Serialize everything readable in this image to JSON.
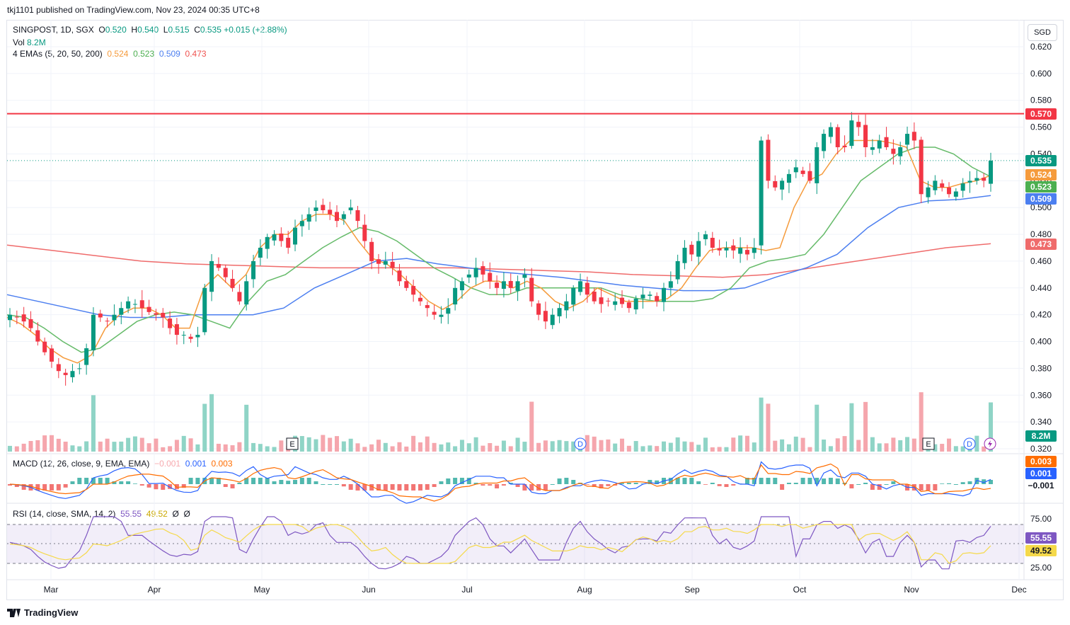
{
  "header": {
    "publisher": "tkj1101 published on TradingView.com, Nov 23, 2024 00:35 UTC+8"
  },
  "symbol": {
    "title": "SINGPOST, 1D, SGX",
    "o_label": "O",
    "o": "0.520",
    "h_label": "H",
    "h": "0.540",
    "l_label": "L",
    "l": "0.515",
    "c_label": "C",
    "c": "0.535",
    "change": "+0.015 (+2.88%)"
  },
  "volume": {
    "label": "Vol",
    "value": "8.2M",
    "axis_label": "8.2M"
  },
  "ema_legend": {
    "label": "4 EMAs (5, 20, 50, 200)",
    "v5": "0.524",
    "v20": "0.523",
    "v50": "0.509",
    "v200": "0.473"
  },
  "macd_legend": {
    "label": "MACD (12, 26, close, 9, EMA, EMA)",
    "hist": "−0.001",
    "macd": "0.001",
    "signal": "0.003"
  },
  "rsi_legend": {
    "label": "RSI (14, close, SMA, 14, 2)",
    "rsi": "55.55",
    "sma": "49.52",
    "ext1": "Ø",
    "ext2": "Ø"
  },
  "currency": "SGD",
  "footer": {
    "brand": "TradingView"
  },
  "colors": {
    "up": "#089981",
    "down": "#f23645",
    "ema5": "#f59b3c",
    "ema20": "#66bb6a",
    "ema50": "#4c7ff0",
    "ema200": "#ef6b6b",
    "level": "#f23645",
    "rsi": "#7e57c2",
    "rsi_ma": "#f5d94a",
    "macd": "#2962ff",
    "signal": "#ff6d00"
  },
  "chart_data": {
    "type": "candlestick",
    "symbol": "SINGPOST",
    "interval": "1D",
    "ylim": [
      0.315,
      0.63
    ],
    "y_ticks": [
      "0.620",
      "0.600",
      "0.580",
      "0.560",
      "0.540",
      "0.520",
      "0.500",
      "0.480",
      "0.460",
      "0.440",
      "0.420",
      "0.400",
      "0.380",
      "0.360",
      "0.340",
      "0.320"
    ],
    "x_ticks": [
      "Mar",
      "Apr",
      "May",
      "Jun",
      "Jul",
      "Aug",
      "Sep",
      "Oct",
      "Nov",
      "Dec"
    ],
    "horizontal_level": 0.57,
    "last_close": 0.535,
    "price_tags": [
      {
        "value": "0.570",
        "kind": "level"
      },
      {
        "value": "0.535",
        "kind": "price"
      },
      {
        "value": "0.524",
        "kind": "ema5"
      },
      {
        "value": "0.523",
        "kind": "ema20"
      },
      {
        "value": "0.509",
        "kind": "ema50"
      },
      {
        "value": "0.473",
        "kind": "ema200"
      }
    ],
    "events": [
      {
        "type": "E",
        "month": "May"
      },
      {
        "type": "D",
        "month": "Aug"
      },
      {
        "type": "E",
        "month": "Nov"
      },
      {
        "type": "D",
        "month": "Nov"
      },
      {
        "type": "split",
        "month": "Nov"
      }
    ],
    "closes_approx": [
      0.42,
      0.418,
      0.415,
      0.41,
      0.4,
      0.392,
      0.385,
      0.378,
      0.375,
      0.378,
      0.38,
      0.395,
      0.42,
      0.418,
      0.415,
      0.42,
      0.425,
      0.43,
      0.428,
      0.425,
      0.422,
      0.42,
      0.418,
      0.41,
      0.405,
      0.405,
      0.402,
      0.405,
      0.44,
      0.46,
      0.455,
      0.448,
      0.44,
      0.43,
      0.445,
      0.46,
      0.47,
      0.478,
      0.48,
      0.475,
      0.47,
      0.485,
      0.49,
      0.495,
      0.5,
      0.498,
      0.495,
      0.49,
      0.495,
      0.5,
      0.49,
      0.475,
      0.46,
      0.458,
      0.46,
      0.455,
      0.445,
      0.44,
      0.435,
      0.43,
      0.425,
      0.42,
      0.42,
      0.425,
      0.44,
      0.445,
      0.45,
      0.455,
      0.45,
      0.445,
      0.44,
      0.445,
      0.44,
      0.445,
      0.45,
      0.43,
      0.42,
      0.415,
      0.42,
      0.425,
      0.43,
      0.44,
      0.445,
      0.435,
      0.43,
      0.428,
      0.43,
      0.43,
      0.428,
      0.425,
      0.432,
      0.435,
      0.435,
      0.43,
      0.44,
      0.445,
      0.46,
      0.47,
      0.465,
      0.475,
      0.48,
      0.47,
      0.468,
      0.47,
      0.468,
      0.47,
      0.465,
      0.47,
      0.55,
      0.52,
      0.515,
      0.52,
      0.525,
      0.53,
      0.525,
      0.52,
      0.545,
      0.555,
      0.56,
      0.545,
      0.545,
      0.565,
      0.56,
      0.545,
      0.545,
      0.55,
      0.545,
      0.54,
      0.545,
      0.555,
      0.55,
      0.51,
      0.515,
      0.52,
      0.515,
      0.51,
      0.512,
      0.518,
      0.52,
      0.522,
      0.52,
      0.535
    ],
    "ema5_approx": [
      0.418,
      0.413,
      0.405,
      0.395,
      0.388,
      0.384,
      0.39,
      0.41,
      0.42,
      0.425,
      0.425,
      0.42,
      0.41,
      0.41,
      0.44,
      0.45,
      0.44,
      0.45,
      0.47,
      0.48,
      0.48,
      0.49,
      0.495,
      0.495,
      0.49,
      0.475,
      0.462,
      0.458,
      0.45,
      0.44,
      0.43,
      0.424,
      0.43,
      0.44,
      0.445,
      0.445,
      0.44,
      0.445,
      0.44,
      0.43,
      0.425,
      0.43,
      0.44,
      0.435,
      0.43,
      0.43,
      0.43,
      0.432,
      0.44,
      0.455,
      0.468,
      0.47,
      0.47,
      0.47,
      0.468,
      0.47,
      0.5,
      0.52,
      0.525,
      0.54,
      0.55,
      0.55,
      0.55,
      0.548,
      0.545,
      0.52,
      0.515,
      0.515,
      0.518,
      0.52,
      0.524
    ],
    "ema20_approx": [
      0.42,
      0.418,
      0.41,
      0.4,
      0.392,
      0.395,
      0.405,
      0.415,
      0.42,
      0.422,
      0.42,
      0.415,
      0.41,
      0.43,
      0.445,
      0.45,
      0.46,
      0.47,
      0.478,
      0.485,
      0.482,
      0.475,
      0.465,
      0.455,
      0.448,
      0.44,
      0.435,
      0.435,
      0.44,
      0.44,
      0.44,
      0.44,
      0.44,
      0.435,
      0.432,
      0.43,
      0.43,
      0.43,
      0.432,
      0.44,
      0.455,
      0.46,
      0.462,
      0.465,
      0.48,
      0.5,
      0.52,
      0.53,
      0.54,
      0.545,
      0.545,
      0.54,
      0.53,
      0.523
    ],
    "ema50_approx": [
      0.435,
      0.43,
      0.425,
      0.42,
      0.418,
      0.418,
      0.42,
      0.42,
      0.42,
      0.425,
      0.44,
      0.45,
      0.46,
      0.462,
      0.458,
      0.455,
      0.452,
      0.45,
      0.448,
      0.445,
      0.442,
      0.44,
      0.438,
      0.438,
      0.44,
      0.448,
      0.455,
      0.465,
      0.485,
      0.5,
      0.505,
      0.506,
      0.509
    ],
    "ema200_approx": [
      0.472,
      0.468,
      0.464,
      0.46,
      0.458,
      0.457,
      0.456,
      0.455,
      0.455,
      0.455,
      0.455,
      0.454,
      0.453,
      0.452,
      0.45,
      0.449,
      0.448,
      0.45,
      0.455,
      0.46,
      0.465,
      0.47,
      0.473
    ]
  }
}
